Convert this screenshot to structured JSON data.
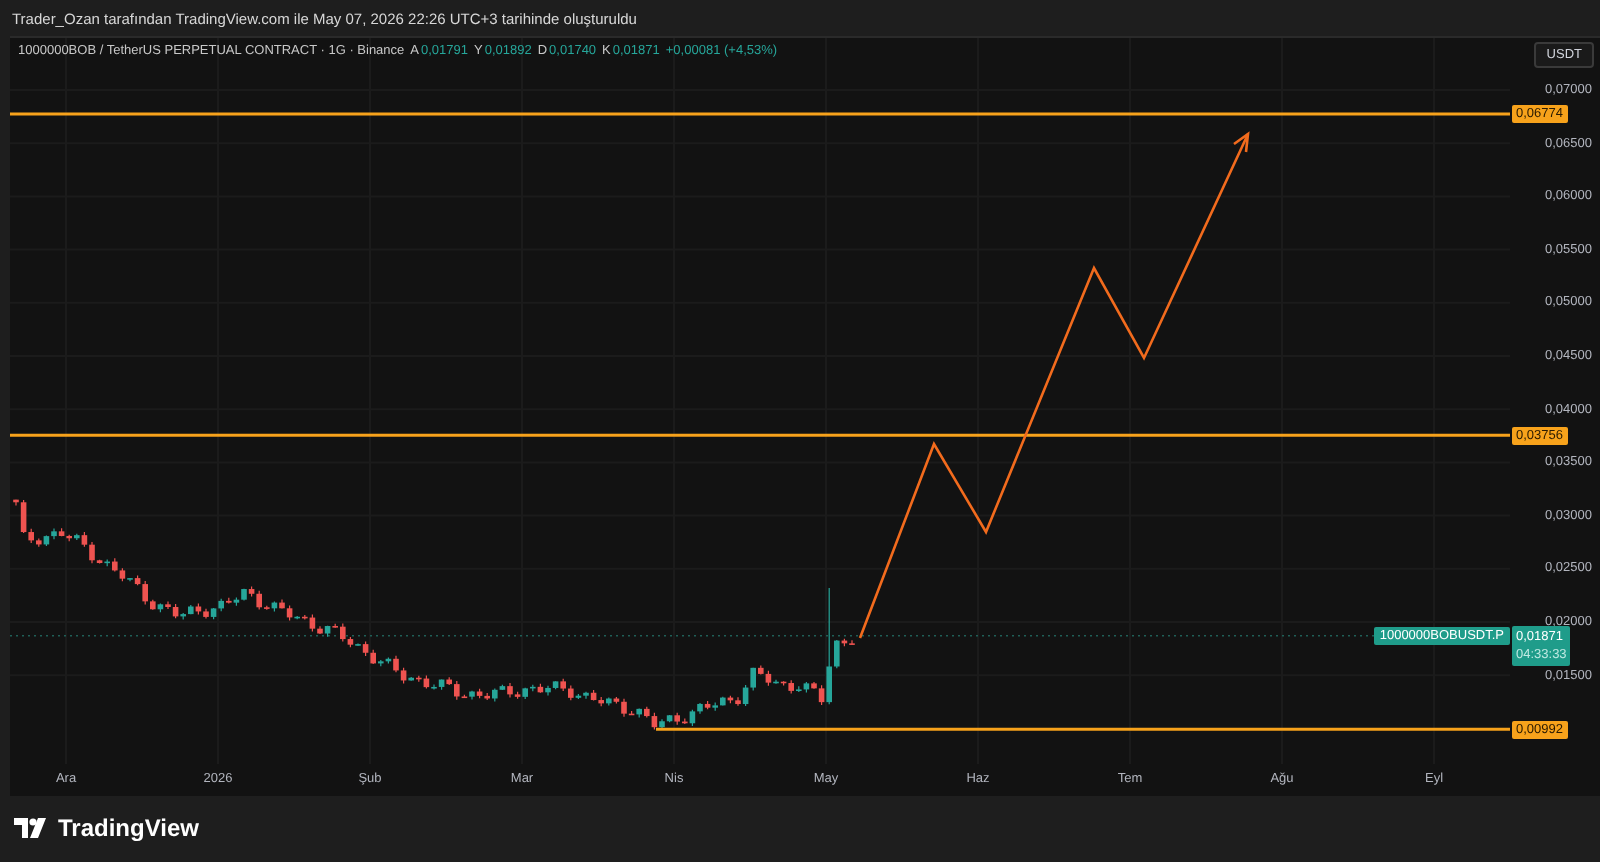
{
  "caption": "Trader_Ozan tarafından TradingView.com ile May 07, 2026 22:26 UTC+3 tarihinde oluşturuldu",
  "legend": {
    "symbol": "1000000BOB / TetherUS PERPETUAL CONTRACT · 1G · Binance",
    "ohlc": [
      {
        "label": "A",
        "value": "0,01791"
      },
      {
        "label": "Y",
        "value": "0,01892"
      },
      {
        "label": "D",
        "value": "0,01740"
      },
      {
        "label": "K",
        "value": "0,01871"
      }
    ],
    "change": "+0,00081 (+4,53%)"
  },
  "currency_button": "USDT",
  "price_axis": [
    "0,07000",
    "0,06500",
    "0,06000",
    "0,05500",
    "0,05000",
    "0,04500",
    "0,04000",
    "0,03500",
    "0,03000",
    "0,02500",
    "0,02000",
    "0,01500"
  ],
  "levels": [
    {
      "value": "0,06774"
    },
    {
      "value": "0,03756"
    },
    {
      "value": "0,00992"
    }
  ],
  "current_price": {
    "symbol": "1000000BOBUSDT.P",
    "price": "0,01871",
    "countdown": "04:33:33"
  },
  "time_axis": [
    "Ara",
    "2026",
    "Şub",
    "Mar",
    "Nis",
    "May",
    "Haz",
    "Tem",
    "Ağu",
    "Eyl"
  ],
  "footer": {
    "logo": "TradingView"
  }
}
